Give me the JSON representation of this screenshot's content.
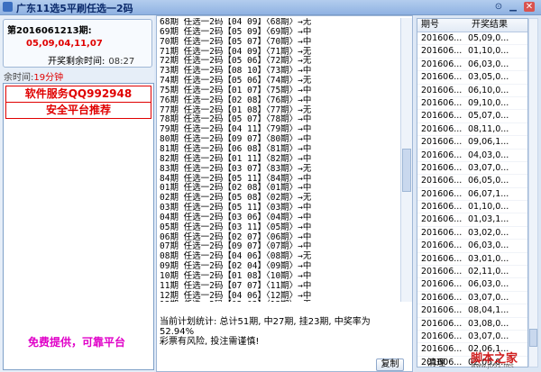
{
  "window": {
    "title": "广东11选5平刷任选一2码",
    "pin_icon": "pin-icon",
    "minimize_icon": "minimize-icon",
    "close_icon": "close-icon"
  },
  "left": {
    "period_label": "第2016061213期:",
    "winning_numbers": "05,09,04,11,07",
    "countdown_label": "开奖剩余时间:",
    "countdown_value": "08:27",
    "remaining_label": "余时间:",
    "remaining_value": "19分钟",
    "ad_lines": [
      "软件服务QQ992948",
      "安全平台推荐",
      "免费提供，可靠平台"
    ]
  },
  "log": {
    "rows": [
      "68期 任选一2码【04 09】〈68期〉→无",
      "69期 任选一2码【05 09】〈69期〉→中",
      "70期 任选一2码【05 07】〈70期〉→中",
      "71期 任选一2码【04 09】〈71期〉→无",
      "72期 任选一2码【05 06】〈72期〉→无",
      "73期 任选一2码【08 10】〈73期〉→中",
      "74期 任选一2码【05 06】〈74期〉→无",
      "75期 任选一2码【01 07】〈75期〉→中",
      "76期 任选一2码【02 08】〈76期〉→中",
      "77期 任选一2码【01 08】〈77期〉→无",
      "78期 任选一2码【05 07】〈78期〉→中",
      "79期 任选一2码【04 11】〈79期〉→中",
      "80期 任选一2码【09 07】〈80期〉→中",
      "81期 任选一2码【06 08】〈81期〉→中",
      "82期 任选一2码【01 11】〈82期〉→中",
      "83期 任选一2码【03 07】〈83期〉→无",
      "84期 任选一2码【05 11】〈84期〉→中",
      "01期 任选一2码【02 08】〈01期〉→中",
      "02期 任选一2码【05 08】〈02期〉→无",
      "03期 任选一2码【05 11】〈03期〉→中",
      "04期 任选一2码【03 06】〈04期〉→中",
      "05期 任选一2码【03 11】〈05期〉→中",
      "06期 任选一2码【02 07】〈06期〉→中",
      "07期 任选一2码【09 07】〈07期〉→中",
      "08期 任选一2码【04 06】〈08期〉→无",
      "09期 任选一2码【02 04】〈09期〉→中",
      "10期 任选一2码【01 08】〈10期〉→中",
      "11期 任选一2码【07 07】〈11期〉→中",
      "12期 任选一2码【04 06】〈12期〉→中",
      "13期 任选一2码【02 03】〈13期〉→无",
      "14期 任选一2码【02 10】 等开"
    ],
    "summary_line1": "当前计划统计: 总计51期, 中27期, 挂23期, 中奖率为",
    "summary_line2": "52.94%",
    "summary_line3": "彩票有风险, 投注需谨慎!",
    "copy_button": "复制"
  },
  "history": {
    "col_period": "期号",
    "col_result": "开奖结果",
    "rows": [
      [
        "201606...",
        "05,09,0..."
      ],
      [
        "201606...",
        "01,10,0..."
      ],
      [
        "201606...",
        "06,03,0..."
      ],
      [
        "201606...",
        "03,05,0..."
      ],
      [
        "201606...",
        "06,10,0..."
      ],
      [
        "201606...",
        "09,10,0..."
      ],
      [
        "201606...",
        "05,07,0..."
      ],
      [
        "201606...",
        "08,11,0..."
      ],
      [
        "201606...",
        "09,06,1..."
      ],
      [
        "201606...",
        "04,03,0..."
      ],
      [
        "201606...",
        "03,07,0..."
      ],
      [
        "201606...",
        "06,05,0..."
      ],
      [
        "201606...",
        "06,07,1..."
      ],
      [
        "201606...",
        "01,10,0..."
      ],
      [
        "201606...",
        "01,03,1..."
      ],
      [
        "201606...",
        "03,02,0..."
      ],
      [
        "201606...",
        "06,03,0..."
      ],
      [
        "201606...",
        "03,01,0..."
      ],
      [
        "201606...",
        "02,11,0..."
      ],
      [
        "201606...",
        "06,03,0..."
      ],
      [
        "201606...",
        "03,07,0..."
      ],
      [
        "201606...",
        "08,04,1..."
      ],
      [
        "201606...",
        "03,08,0..."
      ],
      [
        "201606...",
        "03,07,0..."
      ],
      [
        "201606...",
        "02,06,1..."
      ],
      [
        "201606...",
        "02,05,0..."
      ],
      [
        "201606...",
        "02,07,0..."
      ]
    ],
    "clear_button": "清理",
    "watermark_text": "脚本之家",
    "watermark_url": "www.jb51.net"
  }
}
